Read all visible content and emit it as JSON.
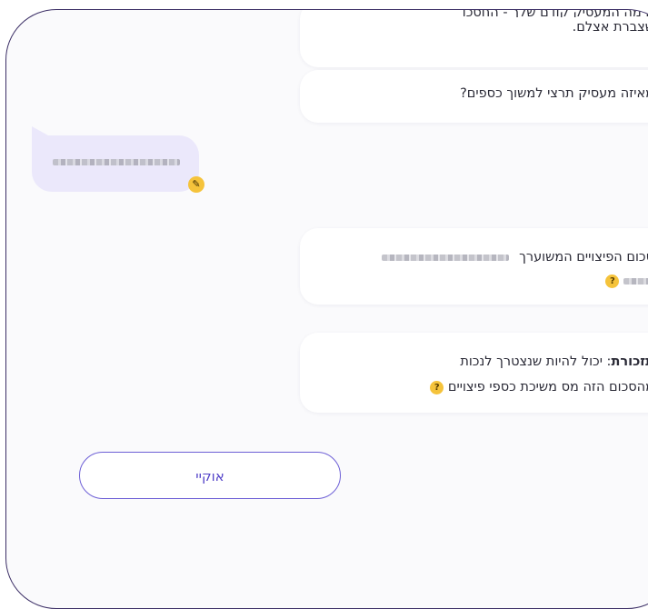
{
  "messages": {
    "bot1": {
      "line1_clipped": "ם מה המעסיק קודם שלך - החסכו",
      "line2": "שצברת אצלם."
    },
    "bot2": {
      "text": "מאיזה מעסיק תרצי למשוך כספים?"
    },
    "bot3": {
      "text": "סכום הפיצויים המשוערך"
    },
    "bot4": {
      "bold": "תזכורת",
      "line1_rest": ": יכול להיות שנצטרך לנכות",
      "line2": "מהסכום הזה מס משיכת כספי פיצויים"
    }
  },
  "icons": {
    "help": "question-mark-icon",
    "edit": "pencil-icon"
  },
  "help_glyph": "?",
  "edit_glyph": "✎",
  "ok_button": {
    "label": "אוקיי"
  },
  "colors": {
    "accent": "#5443c9",
    "help_yellow": "#f5c33b",
    "user_bubble": "#ebe8fb",
    "frame_border": "#3c2f66"
  }
}
